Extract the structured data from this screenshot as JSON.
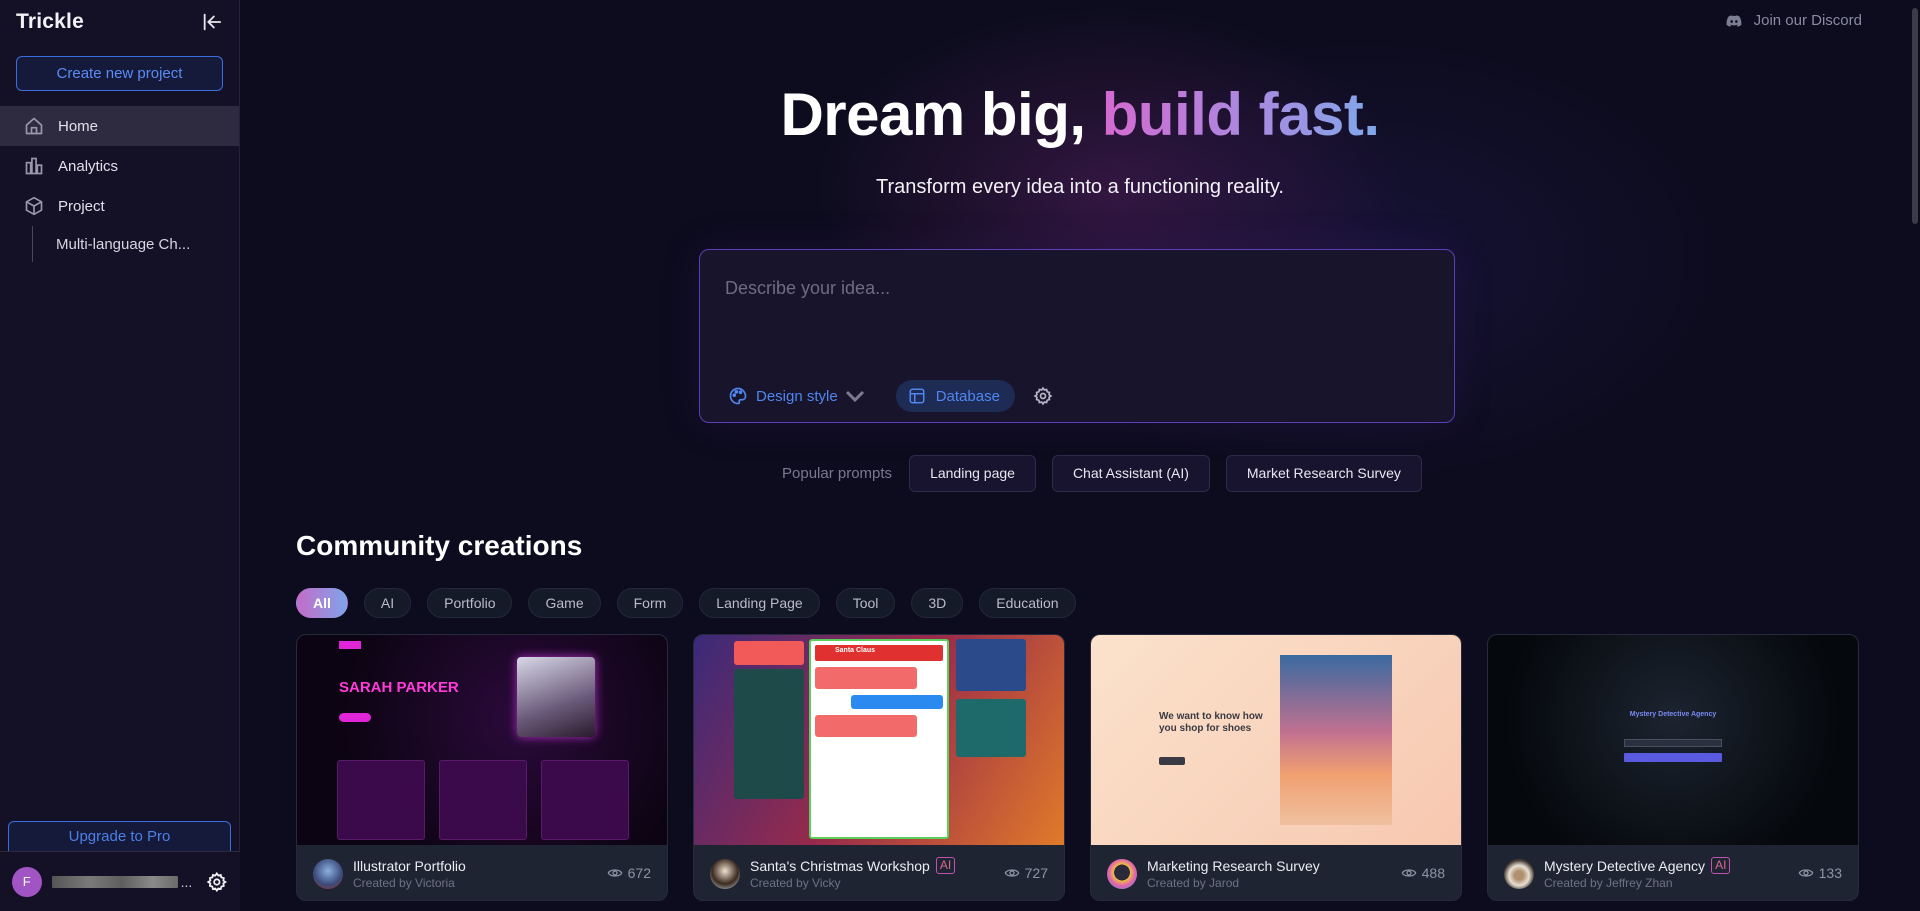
{
  "sidebar": {
    "logo": "Trickle",
    "create_button": "Create new project",
    "nav": [
      {
        "label": "Home",
        "icon": "home-icon",
        "active": true
      },
      {
        "label": "Analytics",
        "icon": "bar-chart-icon",
        "active": false
      },
      {
        "label": "Project",
        "icon": "cube-icon",
        "active": false
      }
    ],
    "sub_items": [
      {
        "label": "Multi-language Ch..."
      }
    ],
    "upgrade_button": "Upgrade to Pro",
    "user": {
      "initial": "F",
      "name_redacted": true,
      "ellipsis": "..."
    }
  },
  "header": {
    "discord_link": "Join our Discord"
  },
  "hero": {
    "title_plain": "Dream big, ",
    "title_gradient": "build fast.",
    "subtitle": "Transform every idea into a functioning reality."
  },
  "prompt": {
    "placeholder": "Describe your idea...",
    "value": "",
    "design_style_label": "Design style",
    "database_label": "Database"
  },
  "popular": {
    "label": "Popular prompts",
    "items": [
      "Landing page",
      "Chat Assistant (AI)",
      "Market Research Survey"
    ]
  },
  "community": {
    "title": "Community creations",
    "filters": [
      {
        "label": "All",
        "active": true
      },
      {
        "label": "AI",
        "active": false
      },
      {
        "label": "Portfolio",
        "active": false
      },
      {
        "label": "Game",
        "active": false
      },
      {
        "label": "Form",
        "active": false
      },
      {
        "label": "Landing Page",
        "active": false
      },
      {
        "label": "Tool",
        "active": false
      },
      {
        "label": "3D",
        "active": false
      },
      {
        "label": "Education",
        "active": false
      }
    ],
    "cards": [
      {
        "title": "Illustrator Portfolio",
        "creator": "Created by Victoria",
        "views": "672",
        "ai": false,
        "preview_heading": "SARAH PARKER"
      },
      {
        "title": "Santa's Christmas Workshop",
        "creator": "Created by Vicky",
        "views": "727",
        "ai": true,
        "preview_heading": "Santa Claus"
      },
      {
        "title": "Marketing Research Survey",
        "creator": "Created by Jarod",
        "views": "488",
        "ai": false,
        "preview_heading": "We want to know how you shop for shoes"
      },
      {
        "title": "Mystery Detective Agency",
        "creator": "Created by Jeffrey Zhan",
        "views": "133",
        "ai": true,
        "preview_heading": "Mystery Detective Agency"
      }
    ],
    "ai_badge": "AI"
  },
  "colors": {
    "accent_blue": "#4f86ef",
    "gradient_start": "#d46ad0",
    "gradient_end": "#7fa8ea",
    "background": "#0d0c1e"
  }
}
